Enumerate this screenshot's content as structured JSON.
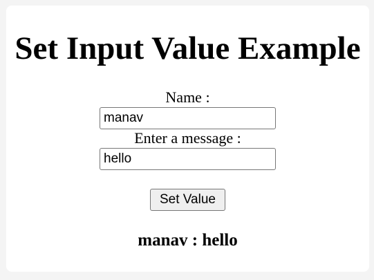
{
  "page": {
    "title": "Set Input Value Example"
  },
  "form": {
    "name_label": "Name :",
    "name_value": "manav",
    "message_label": "Enter a message :",
    "message_value": "hello",
    "button_label": "Set Value"
  },
  "result": {
    "text": "manav : hello"
  }
}
